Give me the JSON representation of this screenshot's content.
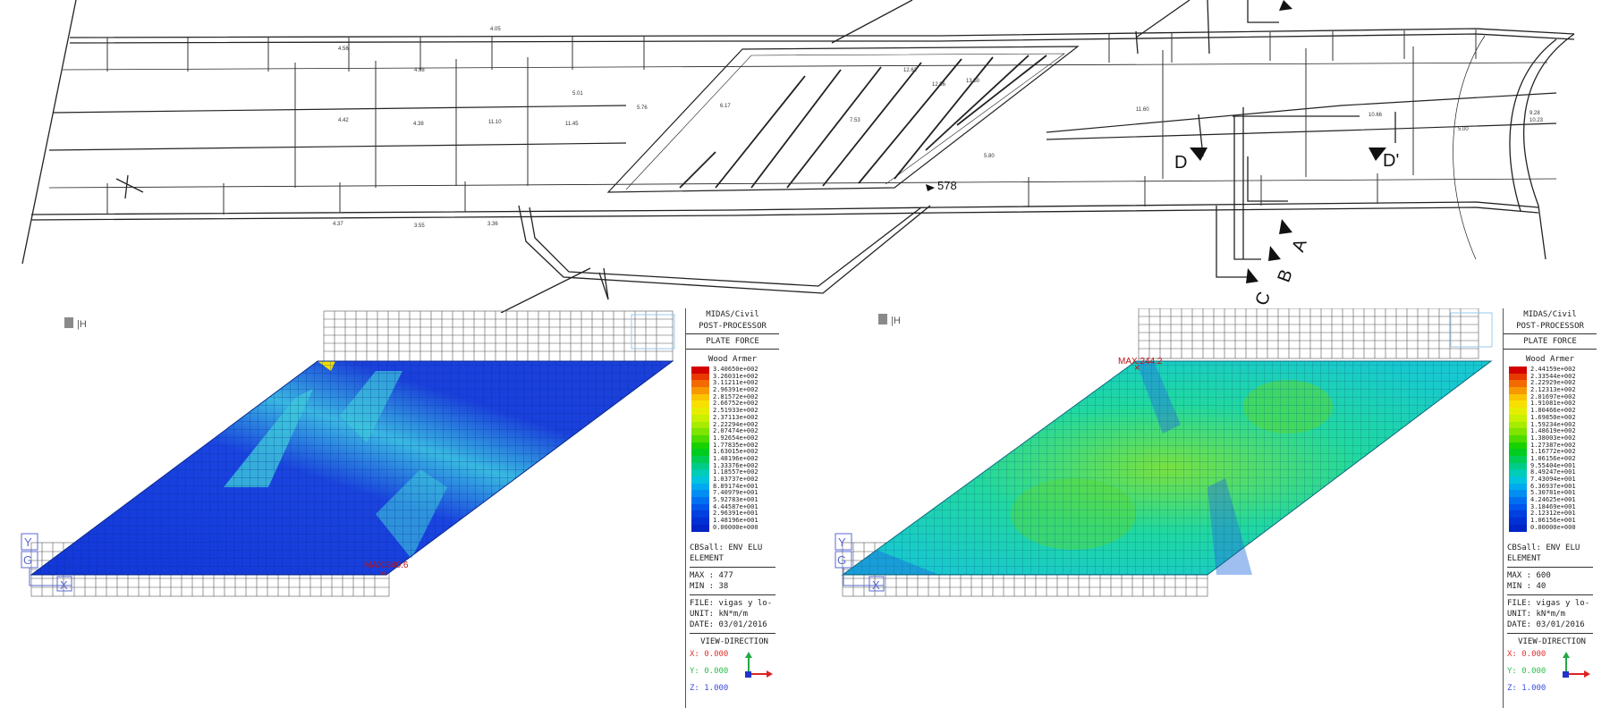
{
  "plan": {
    "section_labels": [
      "D",
      "D'",
      "A",
      "B",
      "C"
    ],
    "dimension_label": "578",
    "level_labels": [
      "4.05",
      "4.56",
      "4.98",
      "5.00",
      "5.01",
      "5.76",
      "6.17",
      "7.53",
      "4.42",
      "4.38",
      "11.10",
      "11.45",
      "11.60",
      "10.66",
      "9.28",
      "12.62",
      "12.96",
      "13.50",
      "5.80",
      "10.23",
      "3.36",
      "3.55",
      "4.37"
    ]
  },
  "panels": [
    {
      "id": "left",
      "header_lines": [
        "MIDAS/Civil",
        "POST-PROCESSOR"
      ],
      "result_type": "PLATE FORCE",
      "result_sub": "Wood Armer",
      "scale_values": [
        "3.40650e+002",
        "3.26031e+002",
        "3.11211e+002",
        "2.96391e+002",
        "2.81572e+002",
        "2.66752e+002",
        "2.51933e+002",
        "2.37113e+002",
        "2.22294e+002",
        "2.07474e+002",
        "1.92654e+002",
        "1.77835e+002",
        "1.63015e+002",
        "1.48196e+002",
        "1.33376e+002",
        "1.18557e+002",
        "1.03737e+002",
        "8.89174e+001",
        "7.40979e+001",
        "5.92783e+001",
        "4.44587e+001",
        "2.96391e+001",
        "1.48196e+001",
        "0.00000e+000"
      ],
      "load_case": "CBSall: ENV ELU",
      "element_label": "ELEMENT",
      "max_label": "MAX : 477",
      "min_label": "MIN : 38",
      "file_label": "FILE: vigas y lo-",
      "unit_label": "UNIT: kN*m/m",
      "date_label": "DATE: 03/01/2016",
      "view_direction": "VIEW-DIRECTION",
      "x_dir": "X: 0.000",
      "y_dir": "Y: 0.000",
      "z_dir": "Z: 1.000",
      "marker_text": "MAX:340.6",
      "field": "dark-blue"
    },
    {
      "id": "right",
      "header_lines": [
        "MIDAS/Civil",
        "POST-PROCESSOR"
      ],
      "result_type": "PLATE FORCE",
      "result_sub": "Wood Armer",
      "scale_values": [
        "2.44159e+002",
        "2.33544e+002",
        "2.22929e+002",
        "2.12313e+002",
        "2.01697e+002",
        "1.91081e+002",
        "1.80466e+002",
        "1.69850e+002",
        "1.59234e+002",
        "1.48619e+002",
        "1.38003e+002",
        "1.27387e+002",
        "1.16772e+002",
        "1.06156e+002",
        "9.55404e+001",
        "8.49247e+001",
        "7.43094e+001",
        "6.36937e+001",
        "5.30781e+001",
        "4.24625e+001",
        "3.18469e+001",
        "2.12312e+001",
        "1.06156e+001",
        "0.00000e+000"
      ],
      "load_case": "CBSall: ENV ELU",
      "element_label": "ELEMENT",
      "max_label": "MAX : 600",
      "min_label": "MIN : 40",
      "file_label": "FILE: vigas y lo-",
      "unit_label": "UNIT: kN*m/m",
      "date_label": "DATE: 03/01/2016",
      "view_direction": "VIEW-DIRECTION",
      "x_dir": "X: 0.000",
      "y_dir": "Y: 0.000",
      "z_dir": "Z: 1.000",
      "marker_text": "MAX:244.2",
      "field": "cyan-green"
    }
  ],
  "scale_colors": [
    "#d40000",
    "#e83a00",
    "#f26a00",
    "#f79800",
    "#fbc400",
    "#f7e000",
    "#e6ee00",
    "#c8f000",
    "#a6ec00",
    "#7ee400",
    "#4cdc00",
    "#18d200",
    "#00cc20",
    "#00cc55",
    "#00cc88",
    "#00ccb8",
    "#00c4dd",
    "#00aaee",
    "#008ef2",
    "#0070f2",
    "#0055ea",
    "#003fe0",
    "#0030d4",
    "#0024c6"
  ],
  "axis_labels": {
    "y": "Y",
    "g": "G",
    "x": "X"
  }
}
